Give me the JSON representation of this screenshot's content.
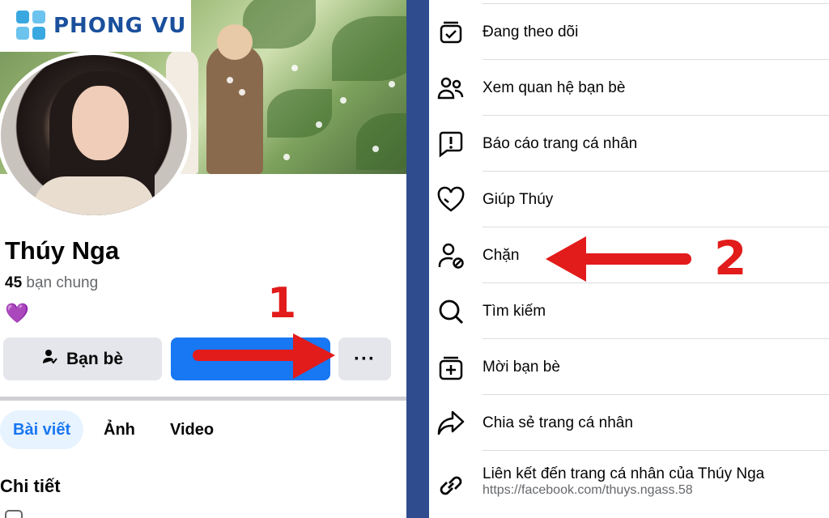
{
  "brand": {
    "logo_text": "PHONG VU"
  },
  "profile": {
    "name": "Thúy Nga",
    "mutual_count": "45",
    "mutual_label": "bạn chung",
    "bio_emoji": "💜"
  },
  "actions": {
    "friends_label": "Bạn bè",
    "more_label": "···"
  },
  "tabs": [
    {
      "label": "Bài viết"
    },
    {
      "label": "Ảnh"
    },
    {
      "label": "Video"
    }
  ],
  "section_title": "Chi tiết",
  "menu": [
    {
      "label": "Đang theo dõi",
      "icon": "following-icon"
    },
    {
      "label": "Xem quan hệ bạn bè",
      "icon": "friendship-icon"
    },
    {
      "label": "Báo cáo trang cá nhân",
      "icon": "report-icon"
    },
    {
      "label": "Giúp Thúy",
      "icon": "heart-icon"
    },
    {
      "label": "Chặn",
      "icon": "block-user-icon"
    },
    {
      "label": "Tìm kiếm",
      "icon": "search-icon"
    },
    {
      "label": "Mời bạn bè",
      "icon": "invite-icon"
    },
    {
      "label": "Chia sẻ trang cá nhân",
      "icon": "share-icon"
    },
    {
      "label": "Liên kết đến trang cá nhân của Thúy Nga",
      "sub": "https://facebook.com/thuys.ngass.58",
      "icon": "link-icon"
    }
  ],
  "annotations": {
    "step1": "1",
    "step2": "2"
  },
  "colors": {
    "accent": "#1877f2",
    "annotation_red": "#e21b1b",
    "separator": "#2f4c8f"
  }
}
